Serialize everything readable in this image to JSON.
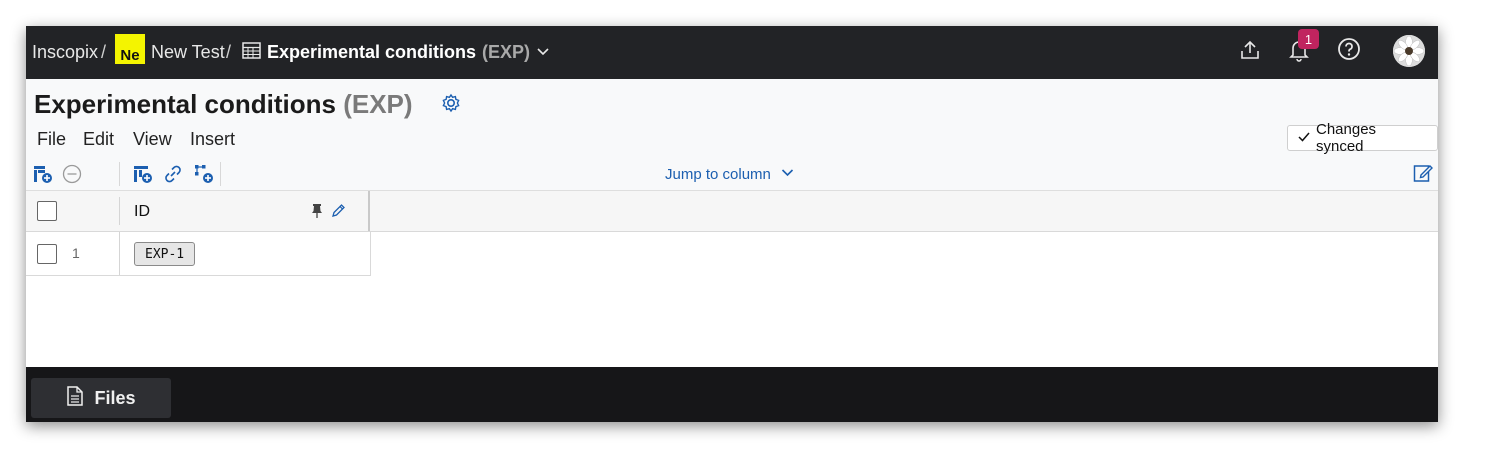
{
  "breadcrumb": {
    "org": "Inscopix",
    "sep1": "/",
    "project_badge": "Ne",
    "project": "New Test",
    "sep2": "/",
    "table": "Experimental conditions",
    "table_abbr": "(EXP)"
  },
  "topbar": {
    "notification_count": "1"
  },
  "page": {
    "title": "Experimental conditions",
    "title_abbr": "(EXP)"
  },
  "menu": {
    "file": "File",
    "edit": "Edit",
    "view": "View",
    "insert": "Insert"
  },
  "sync_status": "Changes synced",
  "toolbar": {
    "jump_to_column": "Jump to column"
  },
  "grid": {
    "columns": [
      "ID"
    ],
    "rows": [
      {
        "num": "1",
        "id": "EXP-1"
      }
    ]
  },
  "bottom": {
    "files_label": "Files"
  },
  "colors": {
    "topbar": "#222326",
    "accent_blue": "#1c5fb0",
    "badge_yellow": "#f4f400",
    "notification_badge": "#c0245f"
  }
}
